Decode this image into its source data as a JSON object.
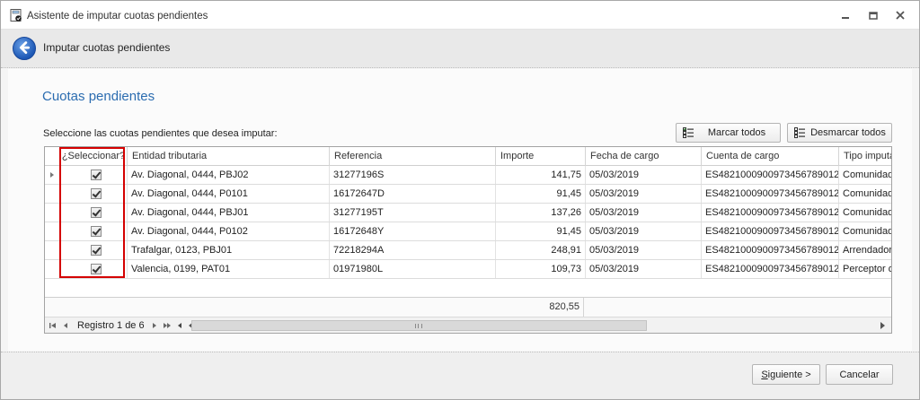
{
  "window": {
    "title": "Asistente de imputar cuotas pendientes"
  },
  "header": {
    "title": "Imputar cuotas pendientes"
  },
  "main": {
    "section_title": "Cuotas pendientes",
    "instruction": "Seleccione las cuotas pendientes que desea imputar:",
    "mark_all_label": "Marcar todos",
    "unmark_all_label": "Desmarcar todos"
  },
  "grid": {
    "columns": [
      "¿Seleccionar?",
      "Entidad tributaria",
      "Referencia",
      "Importe",
      "Fecha de cargo",
      "Cuenta de cargo",
      "Tipo imputa"
    ],
    "rows": [
      {
        "checked": true,
        "entidad": "Av. Diagonal, 0444, PBJ02",
        "referencia": "31277196S",
        "importe": "141,75",
        "fecha": "05/03/2019",
        "cuenta": "ES4821000900973456789012",
        "tipo": "Comunidad"
      },
      {
        "checked": true,
        "entidad": "Av. Diagonal, 0444, P0101",
        "referencia": "16172647D",
        "importe": "91,45",
        "fecha": "05/03/2019",
        "cuenta": "ES4821000900973456789012",
        "tipo": "Comunidad"
      },
      {
        "checked": true,
        "entidad": "Av. Diagonal, 0444, PBJ01",
        "referencia": "31277195T",
        "importe": "137,26",
        "fecha": "05/03/2019",
        "cuenta": "ES4821000900973456789012",
        "tipo": "Comunidad"
      },
      {
        "checked": true,
        "entidad": "Av. Diagonal, 0444, P0102",
        "referencia": "16172648Y",
        "importe": "91,45",
        "fecha": "05/03/2019",
        "cuenta": "ES4821000900973456789012",
        "tipo": "Comunidad"
      },
      {
        "checked": true,
        "entidad": "Trafalgar, 0123, PBJ01",
        "referencia": "72218294A",
        "importe": "248,91",
        "fecha": "05/03/2019",
        "cuenta": "ES4821000900973456789012",
        "tipo": "Arrendador"
      },
      {
        "checked": true,
        "entidad": "Valencia, 0199, PAT01",
        "referencia": "01971980L",
        "importe": "109,73",
        "fecha": "05/03/2019",
        "cuenta": "ES4821000900973456789012",
        "tipo": "Perceptor d"
      }
    ],
    "total": "820,55",
    "navigator": "Registro 1 de 6",
    "selected_row": 1
  },
  "footer": {
    "next_label": "Siguiente >",
    "next_underline": "S",
    "next_rest": "iguiente >",
    "cancel_label": "Cancelar"
  },
  "icons": {
    "app": "calculator-icon",
    "back": "back-arrow-icon",
    "mark": "list-check-icon",
    "unmark": "list-uncheck-icon"
  },
  "colors": {
    "accent": "#2b6cb0",
    "highlight": "#d40000"
  }
}
